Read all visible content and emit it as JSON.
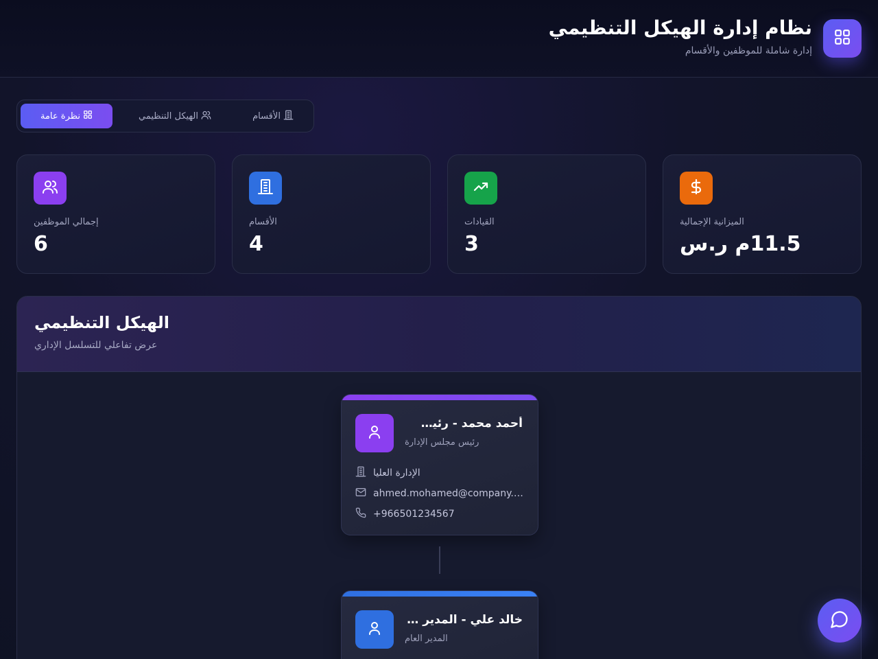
{
  "header": {
    "title": "نظام إدارة الهيكل التنظيمي",
    "subtitle": "إدارة شاملة للموظفين والأقسام",
    "logo_icon": "grid-icon"
  },
  "tabs": [
    {
      "label": "نظرة عامة",
      "icon": "grid-icon",
      "active": true
    },
    {
      "label": "الهيكل التنظيمي",
      "icon": "users-icon",
      "active": false
    },
    {
      "label": "الأقسام",
      "icon": "building-icon",
      "active": false
    }
  ],
  "stats": [
    {
      "label": "إجمالي الموظفين",
      "value": "6",
      "icon": "users-icon",
      "color": "#8b3ff0"
    },
    {
      "label": "الأقسام",
      "value": "4",
      "icon": "building-icon",
      "color": "#2f6fe0"
    },
    {
      "label": "القيادات",
      "value": "3",
      "icon": "trending-up-icon",
      "color": "#16a34a"
    },
    {
      "label": "الميزانية الإجمالية",
      "value": "11.5م ر.س",
      "icon": "dollar-icon",
      "color": "#ea6a0c"
    }
  ],
  "org": {
    "title": "الهيكل التنظيمي",
    "subtitle": "عرض تفاعلي للتسلسل الإداري",
    "people": [
      {
        "name": "أحمد محمد - رئيس مجلس الإدارة",
        "role": "رئيس مجلس الإدارة",
        "department": "الإدارة العليا",
        "email": "ahmed.mohamed@company.com",
        "phone": "+966501234567",
        "accent": "#8b3ff0"
      },
      {
        "name": "خالد علي - المدير العام",
        "role": "المدير العام",
        "accent": "#2f6fe0"
      }
    ]
  },
  "chat": {
    "icon": "chat-icon"
  }
}
